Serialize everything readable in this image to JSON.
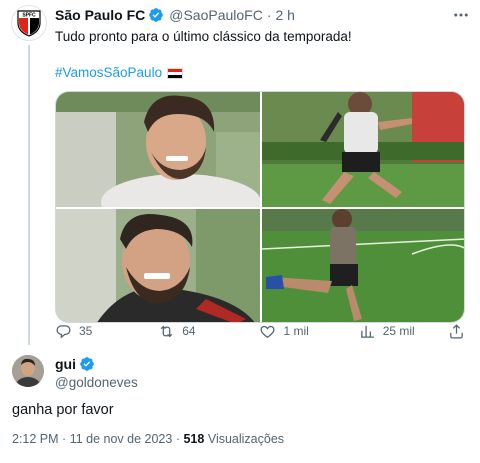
{
  "tweet": {
    "author_name": "São Paulo FC",
    "author_handle": "@SaoPauloFC",
    "separator": "·",
    "time_ago": "2 h",
    "more_icon": "more-horizontal-icon",
    "text": "Tudo pronto para o último clássico da temporada!",
    "hashtag": "#VamosSãoPaulo",
    "flag_icon": "sao-paulo-flag-icon",
    "avatar_icon": "spfc-crest-icon",
    "avatar_initials": "SPFC",
    "media": [
      {
        "name": "player-smiling-portrait-1"
      },
      {
        "name": "player-running-training"
      },
      {
        "name": "player-smiling-portrait-2"
      },
      {
        "name": "player-kicking-ball"
      }
    ],
    "actions": {
      "reply_count": "35",
      "retweet_count": "64",
      "like_count": "1 mil",
      "views_count": "25 mil"
    }
  },
  "reply": {
    "author_name": "gui",
    "author_handle": "@goldoneves",
    "text": "ganha por favor",
    "time": "2:12 PM",
    "separator": "·",
    "date": "11 de nov de 2023",
    "views_count": "518",
    "views_label": "Visualizações"
  },
  "colors": {
    "accent": "#1d9bf0",
    "text": "#0f1419",
    "muted": "#536471",
    "spfc_red": "#e2231a"
  }
}
